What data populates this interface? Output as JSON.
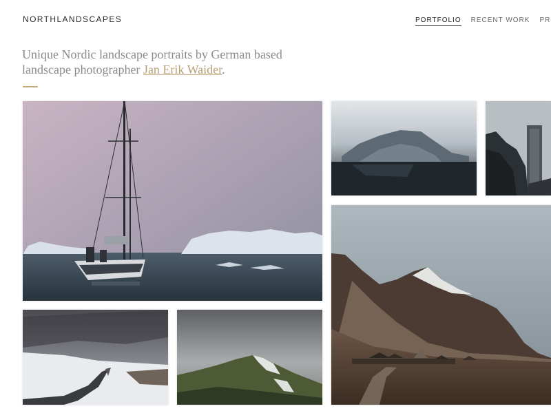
{
  "header": {
    "brand": "NORTHLANDSCAPES",
    "nav": [
      {
        "label": "PORTFOLIO",
        "active": true
      },
      {
        "label": "RECENT WORK",
        "active": false
      },
      {
        "label": "PROF",
        "active": false
      }
    ]
  },
  "intro": {
    "text_before": "Unique Nordic landscape portraits by German based landscape photographer ",
    "link_text": "Jan Erik Waider",
    "text_after": "."
  },
  "colors": {
    "accent": "#c7a87a",
    "link": "#b8a075",
    "intro_text": "#8a8a8a",
    "brand_text": "#2b2b2b"
  },
  "gallery": [
    {
      "name": "sailboat-icebergs-photo"
    },
    {
      "name": "foggy-iceberg-photo"
    },
    {
      "name": "dark-rocks-photo"
    },
    {
      "name": "mountain-village-photo"
    },
    {
      "name": "snowy-road-photo"
    },
    {
      "name": "misty-green-mountain-photo"
    }
  ]
}
